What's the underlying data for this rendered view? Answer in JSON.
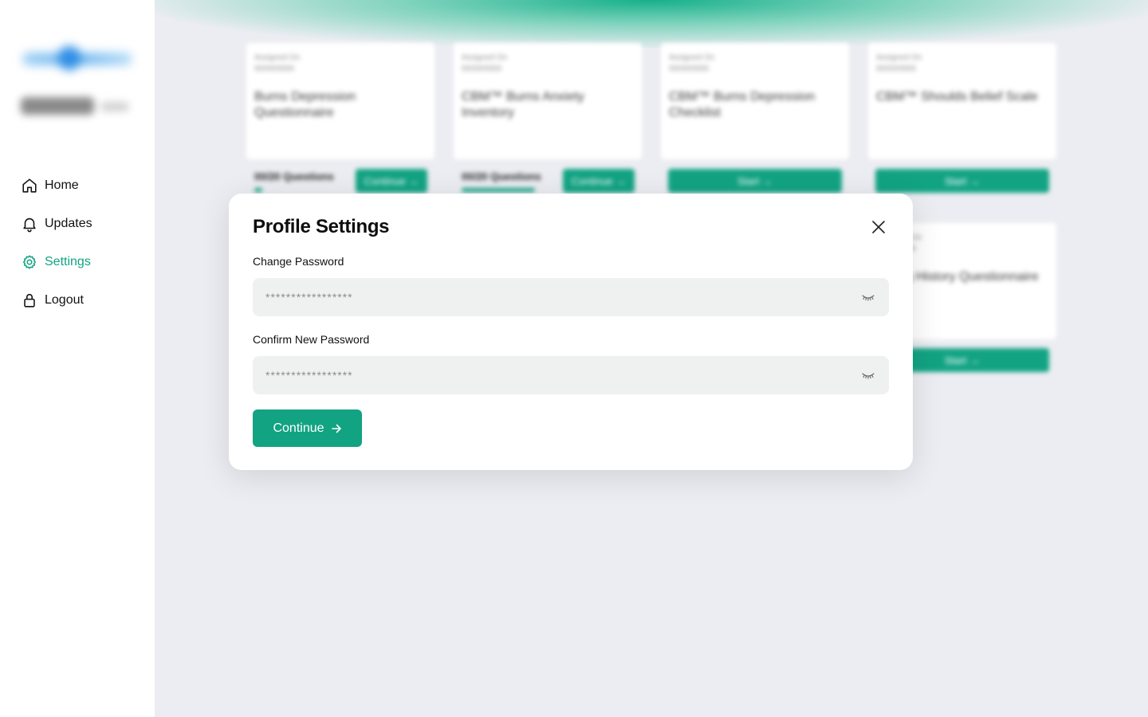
{
  "sidebar": {
    "items": [
      {
        "label": "Home",
        "icon": "home-icon"
      },
      {
        "label": "Updates",
        "icon": "bell-icon"
      },
      {
        "label": "Settings",
        "icon": "gear-icon",
        "active": true
      },
      {
        "label": "Logout",
        "icon": "lock-icon"
      }
    ]
  },
  "colors": {
    "accent": "#12a383",
    "background": "#ecedf2",
    "field_bg": "#eef1f0"
  },
  "background_cards": [
    {
      "meta": [
        "Assigned On",
        "00/00/0000"
      ],
      "title": "Burns Depression Questionnaire",
      "questions": "00/20 Questions",
      "button": "Continue →"
    },
    {
      "meta": [
        "Assigned On",
        "00/00/0000"
      ],
      "title": "CBM™ Burns Anxiety Inventory",
      "questions": "00/20 Questions",
      "button": "Continue →"
    },
    {
      "meta": [
        "Assigned On",
        "00/00/0000"
      ],
      "title": "CBM™ Burns Depression Checklist",
      "questions": "",
      "button": "Start →"
    },
    {
      "meta": [
        "Assigned On",
        "00/00/0000"
      ],
      "title": "CBM™ Shoulds Belief Scale",
      "questions": "",
      "button": "Start →"
    },
    {
      "meta": [
        "Assigned On",
        "00/00/0000"
      ],
      "title": "Eating History Questionnaire",
      "questions": "",
      "button": "Start →"
    }
  ],
  "modal": {
    "title": "Profile Settings",
    "change_password_label": "Change Password",
    "change_password_placeholder": "*****************",
    "confirm_password_label": "Confirm New Password",
    "confirm_password_placeholder": "*****************",
    "continue_label": "Continue"
  }
}
